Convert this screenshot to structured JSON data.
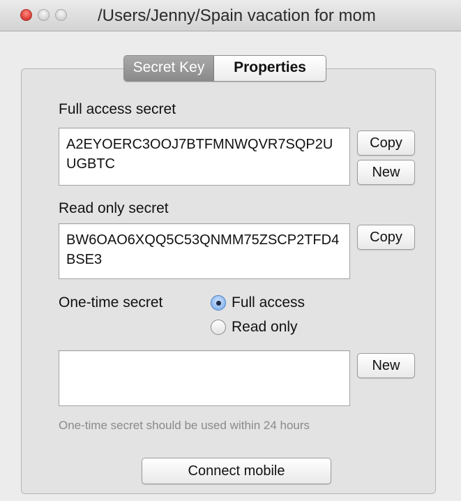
{
  "window": {
    "title": "/Users/Jenny/Spain vacation for mom"
  },
  "tabs": [
    {
      "label": "Secret Key",
      "active": true
    },
    {
      "label": "Properties",
      "active": false
    }
  ],
  "full_access": {
    "label": "Full access secret",
    "value": "A2EYOERC3OOJ7BTFMNWQVR7SQP2UUGBTC",
    "copy_label": "Copy",
    "new_label": "New"
  },
  "read_only": {
    "label": "Read only secret",
    "value": "BW6OAO6XQQ5C53QNMM75ZSCP2TFD4BSE3",
    "copy_label": "Copy"
  },
  "one_time": {
    "label": "One-time secret",
    "options": [
      {
        "label": "Full access",
        "selected": true
      },
      {
        "label": "Read only",
        "selected": false
      }
    ],
    "value": "",
    "new_label": "New",
    "hint": "One-time secret should be used within 24 hours"
  },
  "connect_label": "Connect mobile",
  "colors": {
    "close_light": "#e0443e",
    "active_tab": "#8a8a8a",
    "radio_selected": "#8db8ee"
  },
  "icons": [
    "close-light-icon",
    "minimize-light-icon",
    "zoom-light-icon",
    "radio-checked-icon",
    "radio-unchecked-icon"
  ]
}
